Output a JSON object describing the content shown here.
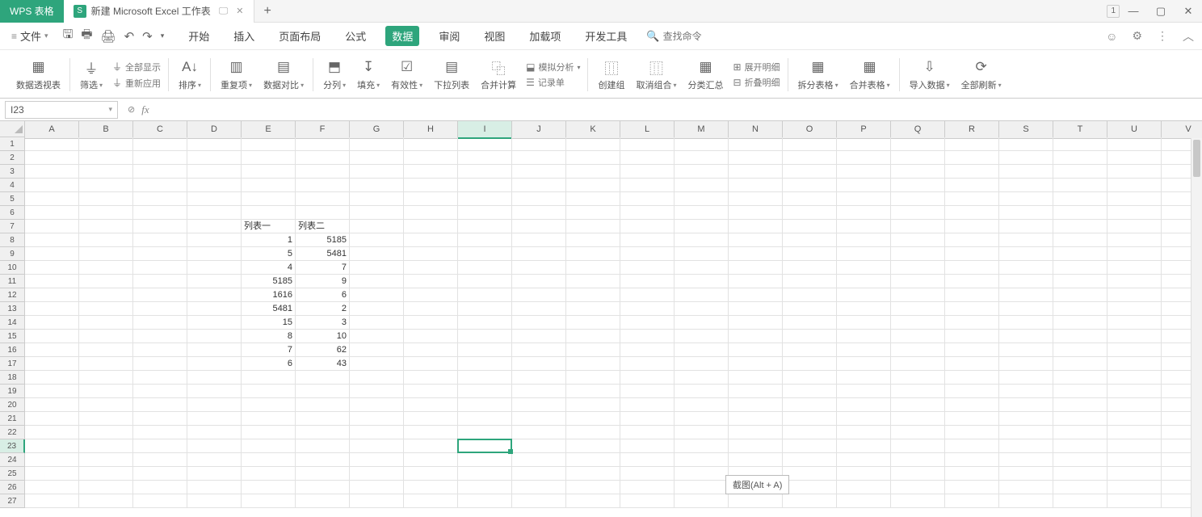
{
  "title_bar": {
    "home_tab": "WPS 表格",
    "doc_icon": "S",
    "doc_name": "新建 Microsoft Excel 工作表",
    "add": "+",
    "win_badge": "1"
  },
  "menu": {
    "file": "文件",
    "tabs": [
      "开始",
      "插入",
      "页面布局",
      "公式",
      "数据",
      "审阅",
      "视图",
      "加载项",
      "开发工具"
    ],
    "active_index": 4,
    "search_placeholder": "查找命令"
  },
  "ribbon": {
    "pivot": "数据透视表",
    "filter": "筛选",
    "show_all": "全部显示",
    "reapply": "重新应用",
    "sort": "排序",
    "dup": "重复项",
    "compare": "数据对比",
    "split_col": "分列",
    "fill": "填充",
    "valid": "有效性",
    "dropdown": "下拉列表",
    "merge_calc": "合并计算",
    "sim": "模拟分析",
    "record": "记录单",
    "group": "创建组",
    "ungroup": "取消组合",
    "subtotal": "分类汇总",
    "show_detail": "展开明细",
    "hide_detail": "折叠明细",
    "split_tbl": "拆分表格",
    "merge_tbl": "合并表格",
    "import": "导入数据",
    "refresh": "全部刷新"
  },
  "fx": {
    "name_ref": "I23",
    "fx": "fx",
    "formula": ""
  },
  "sheet": {
    "cols": [
      "A",
      "B",
      "C",
      "D",
      "E",
      "F",
      "G",
      "H",
      "I",
      "J",
      "K",
      "L",
      "M",
      "N",
      "O",
      "P",
      "Q",
      "R",
      "S",
      "T",
      "U",
      "V"
    ],
    "rows": 27,
    "sel_col_index": 8,
    "sel_row_index": 22,
    "data": [
      {
        "r": 7,
        "c": 4,
        "v": "列表一",
        "align": "l"
      },
      {
        "r": 7,
        "c": 5,
        "v": "列表二",
        "align": "l"
      },
      {
        "r": 8,
        "c": 4,
        "v": "1",
        "align": "r"
      },
      {
        "r": 8,
        "c": 5,
        "v": "5185",
        "align": "r"
      },
      {
        "r": 9,
        "c": 4,
        "v": "5",
        "align": "r"
      },
      {
        "r": 9,
        "c": 5,
        "v": "5481",
        "align": "r"
      },
      {
        "r": 10,
        "c": 4,
        "v": "4",
        "align": "r"
      },
      {
        "r": 10,
        "c": 5,
        "v": "7",
        "align": "r"
      },
      {
        "r": 11,
        "c": 4,
        "v": "5185",
        "align": "r"
      },
      {
        "r": 11,
        "c": 5,
        "v": "9",
        "align": "r"
      },
      {
        "r": 12,
        "c": 4,
        "v": "1616",
        "align": "r"
      },
      {
        "r": 12,
        "c": 5,
        "v": "6",
        "align": "r"
      },
      {
        "r": 13,
        "c": 4,
        "v": "5481",
        "align": "r"
      },
      {
        "r": 13,
        "c": 5,
        "v": "2",
        "align": "r"
      },
      {
        "r": 14,
        "c": 4,
        "v": "15",
        "align": "r"
      },
      {
        "r": 14,
        "c": 5,
        "v": "3",
        "align": "r"
      },
      {
        "r": 15,
        "c": 4,
        "v": "8",
        "align": "r"
      },
      {
        "r": 15,
        "c": 5,
        "v": "10",
        "align": "r"
      },
      {
        "r": 16,
        "c": 4,
        "v": "7",
        "align": "r"
      },
      {
        "r": 16,
        "c": 5,
        "v": "62",
        "align": "r"
      },
      {
        "r": 17,
        "c": 4,
        "v": "6",
        "align": "r"
      },
      {
        "r": 17,
        "c": 5,
        "v": "43",
        "align": "r"
      }
    ]
  },
  "tooltip": "截图(Alt + A)"
}
